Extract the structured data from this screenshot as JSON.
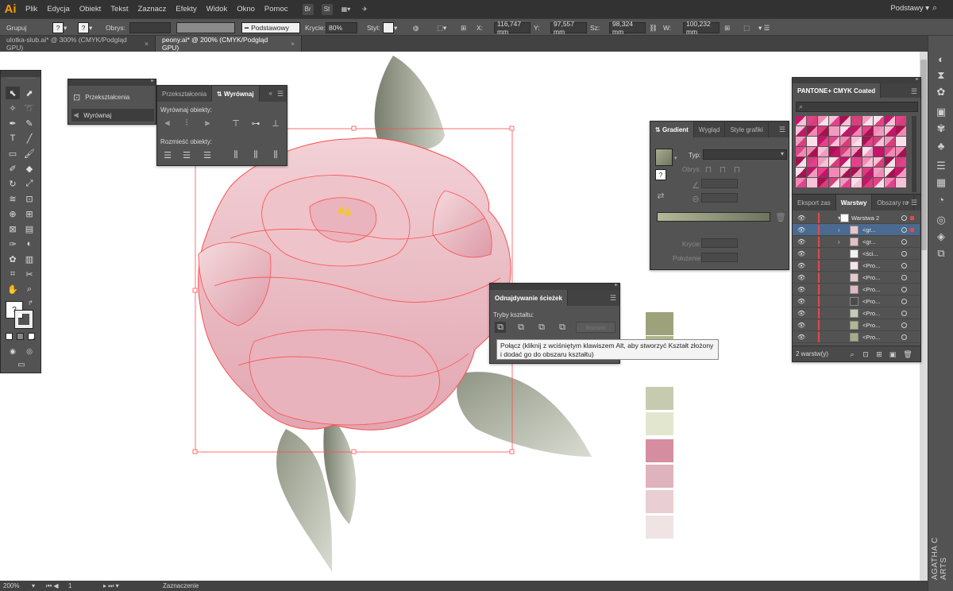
{
  "app": {
    "logo": "Ai",
    "workspace": "Podstawy"
  },
  "menu": [
    "Plik",
    "Edycja",
    "Obiekt",
    "Tekst",
    "Zaznacz",
    "Efekty",
    "Widok",
    "Okno",
    "Pomoc"
  ],
  "menu_icons": {
    "br": "Br",
    "st": "St"
  },
  "control": {
    "group_label": "Grupuj",
    "stroke_label": "Obrys:",
    "stroke_profile": "Podstawowy",
    "opacity_label": "Krycie:",
    "opacity_value": "80%",
    "style_label": "Styl:",
    "x_label": "X:",
    "x_value": "116,747 mm",
    "y_label": "Y:",
    "y_value": "97,557 mm",
    "w_label": "Sz:",
    "w_value": "98,324 mm",
    "h_label": "W:",
    "h_value": "100,232 mm",
    "question": "?"
  },
  "tabs": [
    {
      "label": "ulotka-slub.ai* @ 300% (CMYK/Podgląd GPU)",
      "close": "×"
    },
    {
      "label": "peony.ai* @ 200% (CMYK/Podgląd GPU)",
      "close": "×"
    }
  ],
  "transform_panel": {
    "item1": "Przekształcenia",
    "item2": "Wyrównaj"
  },
  "align_panel": {
    "tab1": "Przekształcenia",
    "tab2": "Wyrównaj",
    "section1": "Wyrównaj obiekty:",
    "section2": "Rozmieść obiekty:"
  },
  "gradient_panel": {
    "tab1": "Gradient",
    "tab2": "Wygląd",
    "tab3": "Style grafiki",
    "type_label": "Typ:",
    "stroke_label": "Obrys:",
    "opacity_label": "Krycie:",
    "position_label": "Położenie:",
    "question": "?"
  },
  "pantone_panel": {
    "title": "PANTONE+ CMYK Coated"
  },
  "layers_panel": {
    "tab1": "Eksport zas",
    "tab2": "Warstwy",
    "tab3": "Obszary ro",
    "footer": "2 warstw(y)",
    "rows": [
      {
        "name": "Warstwa 2",
        "color": "#ffffff"
      },
      {
        "name": "<gr...",
        "color": "#e8c6cb"
      },
      {
        "name": "<gr...",
        "color": "#e5c0c6"
      },
      {
        "name": "<ści...",
        "color": "#f2f2f2"
      },
      {
        "name": "<Pro...",
        "color": "#f2e6e8"
      },
      {
        "name": "<Pro...",
        "color": "#e7c8cd"
      },
      {
        "name": "<Pro...",
        "color": "#e3b8c0"
      },
      {
        "name": "<Pro...",
        "color": "#4a4a4a"
      },
      {
        "name": "<Pro...",
        "color": "#c5cbb3"
      },
      {
        "name": "<Pro...",
        "color": "#b1b891"
      },
      {
        "name": "<Pro...",
        "color": "#a6ad86"
      }
    ]
  },
  "pathfinder_panel": {
    "title": "Odnajdywanie ścieżek",
    "shape_modes": "Tryby kształtu:",
    "expand": "Rozwiń"
  },
  "tooltip": "Połącz (kliknij z wciśniętym klawiszem Alt, aby stworzyć Kształt złożony i dodać go do obszaru kształtu)",
  "swatches": [
    "#9ea27a",
    "#b0b68c",
    "#c6cbb0",
    "#e3e6cf",
    "#d58ea0",
    "#dfb3bd",
    "#e9cfd3",
    "#f0e3e4"
  ],
  "status": {
    "zoom": "200%",
    "page": "1",
    "tool": "Zaznaczenie"
  },
  "watermark": "AGATHA C ARTS"
}
